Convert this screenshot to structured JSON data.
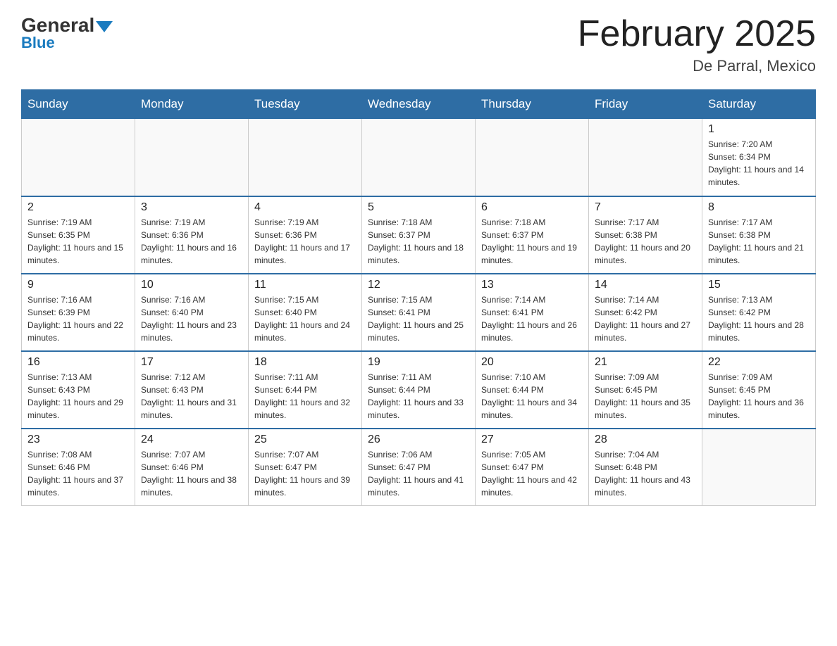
{
  "logo": {
    "general": "General",
    "blue": "Blue"
  },
  "header": {
    "month_title": "February 2025",
    "location": "De Parral, Mexico"
  },
  "days_of_week": [
    "Sunday",
    "Monday",
    "Tuesday",
    "Wednesday",
    "Thursday",
    "Friday",
    "Saturday"
  ],
  "weeks": [
    [
      {
        "day": "",
        "info": ""
      },
      {
        "day": "",
        "info": ""
      },
      {
        "day": "",
        "info": ""
      },
      {
        "day": "",
        "info": ""
      },
      {
        "day": "",
        "info": ""
      },
      {
        "day": "",
        "info": ""
      },
      {
        "day": "1",
        "info": "Sunrise: 7:20 AM\nSunset: 6:34 PM\nDaylight: 11 hours and 14 minutes."
      }
    ],
    [
      {
        "day": "2",
        "info": "Sunrise: 7:19 AM\nSunset: 6:35 PM\nDaylight: 11 hours and 15 minutes."
      },
      {
        "day": "3",
        "info": "Sunrise: 7:19 AM\nSunset: 6:36 PM\nDaylight: 11 hours and 16 minutes."
      },
      {
        "day": "4",
        "info": "Sunrise: 7:19 AM\nSunset: 6:36 PM\nDaylight: 11 hours and 17 minutes."
      },
      {
        "day": "5",
        "info": "Sunrise: 7:18 AM\nSunset: 6:37 PM\nDaylight: 11 hours and 18 minutes."
      },
      {
        "day": "6",
        "info": "Sunrise: 7:18 AM\nSunset: 6:37 PM\nDaylight: 11 hours and 19 minutes."
      },
      {
        "day": "7",
        "info": "Sunrise: 7:17 AM\nSunset: 6:38 PM\nDaylight: 11 hours and 20 minutes."
      },
      {
        "day": "8",
        "info": "Sunrise: 7:17 AM\nSunset: 6:38 PM\nDaylight: 11 hours and 21 minutes."
      }
    ],
    [
      {
        "day": "9",
        "info": "Sunrise: 7:16 AM\nSunset: 6:39 PM\nDaylight: 11 hours and 22 minutes."
      },
      {
        "day": "10",
        "info": "Sunrise: 7:16 AM\nSunset: 6:40 PM\nDaylight: 11 hours and 23 minutes."
      },
      {
        "day": "11",
        "info": "Sunrise: 7:15 AM\nSunset: 6:40 PM\nDaylight: 11 hours and 24 minutes."
      },
      {
        "day": "12",
        "info": "Sunrise: 7:15 AM\nSunset: 6:41 PM\nDaylight: 11 hours and 25 minutes."
      },
      {
        "day": "13",
        "info": "Sunrise: 7:14 AM\nSunset: 6:41 PM\nDaylight: 11 hours and 26 minutes."
      },
      {
        "day": "14",
        "info": "Sunrise: 7:14 AM\nSunset: 6:42 PM\nDaylight: 11 hours and 27 minutes."
      },
      {
        "day": "15",
        "info": "Sunrise: 7:13 AM\nSunset: 6:42 PM\nDaylight: 11 hours and 28 minutes."
      }
    ],
    [
      {
        "day": "16",
        "info": "Sunrise: 7:13 AM\nSunset: 6:43 PM\nDaylight: 11 hours and 29 minutes."
      },
      {
        "day": "17",
        "info": "Sunrise: 7:12 AM\nSunset: 6:43 PM\nDaylight: 11 hours and 31 minutes."
      },
      {
        "day": "18",
        "info": "Sunrise: 7:11 AM\nSunset: 6:44 PM\nDaylight: 11 hours and 32 minutes."
      },
      {
        "day": "19",
        "info": "Sunrise: 7:11 AM\nSunset: 6:44 PM\nDaylight: 11 hours and 33 minutes."
      },
      {
        "day": "20",
        "info": "Sunrise: 7:10 AM\nSunset: 6:44 PM\nDaylight: 11 hours and 34 minutes."
      },
      {
        "day": "21",
        "info": "Sunrise: 7:09 AM\nSunset: 6:45 PM\nDaylight: 11 hours and 35 minutes."
      },
      {
        "day": "22",
        "info": "Sunrise: 7:09 AM\nSunset: 6:45 PM\nDaylight: 11 hours and 36 minutes."
      }
    ],
    [
      {
        "day": "23",
        "info": "Sunrise: 7:08 AM\nSunset: 6:46 PM\nDaylight: 11 hours and 37 minutes."
      },
      {
        "day": "24",
        "info": "Sunrise: 7:07 AM\nSunset: 6:46 PM\nDaylight: 11 hours and 38 minutes."
      },
      {
        "day": "25",
        "info": "Sunrise: 7:07 AM\nSunset: 6:47 PM\nDaylight: 11 hours and 39 minutes."
      },
      {
        "day": "26",
        "info": "Sunrise: 7:06 AM\nSunset: 6:47 PM\nDaylight: 11 hours and 41 minutes."
      },
      {
        "day": "27",
        "info": "Sunrise: 7:05 AM\nSunset: 6:47 PM\nDaylight: 11 hours and 42 minutes."
      },
      {
        "day": "28",
        "info": "Sunrise: 7:04 AM\nSunset: 6:48 PM\nDaylight: 11 hours and 43 minutes."
      },
      {
        "day": "",
        "info": ""
      }
    ]
  ]
}
